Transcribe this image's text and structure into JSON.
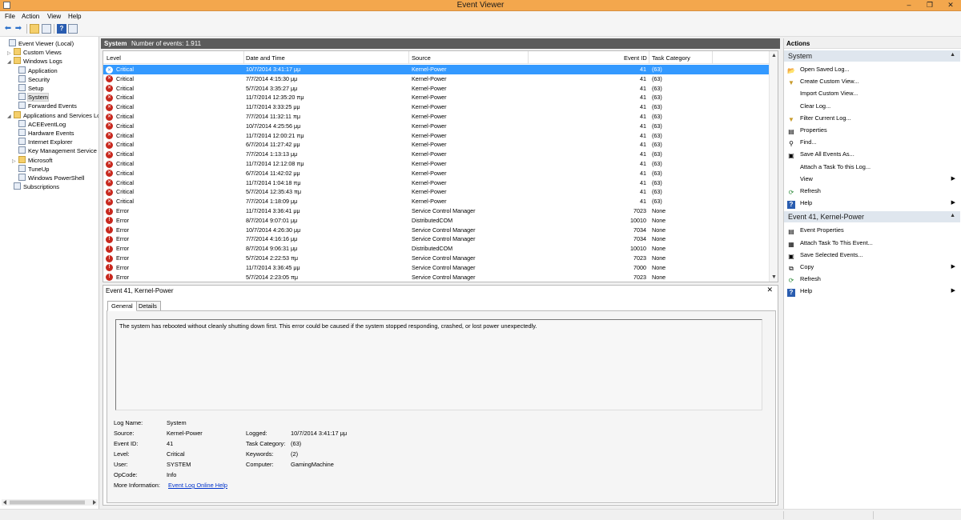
{
  "window": {
    "title": "Event Viewer",
    "minimize_glyph": "–",
    "restore_glyph": "❐",
    "close_glyph": "✕"
  },
  "menu": [
    {
      "label": "File"
    },
    {
      "label": "Action"
    },
    {
      "label": "View"
    },
    {
      "label": "Help"
    }
  ],
  "toolbar": {
    "back_icon": "back-arrow-icon",
    "forward_icon": "forward-arrow-icon",
    "up_icon": "folder-up-icon",
    "console_icon": "console-tree-icon",
    "help_icon": "help-icon",
    "pane_icon": "action-pane-icon"
  },
  "tree": {
    "items": [
      {
        "label": "Event Viewer (Local)",
        "level": 0,
        "expander": "",
        "icon": "log"
      },
      {
        "label": "Custom Views",
        "level": 1,
        "expander": "▷",
        "icon": "folder"
      },
      {
        "label": "Windows Logs",
        "level": 1,
        "expander": "◢",
        "icon": "folder"
      },
      {
        "label": "Application",
        "level": 2,
        "expander": "",
        "icon": "log"
      },
      {
        "label": "Security",
        "level": 2,
        "expander": "",
        "icon": "log"
      },
      {
        "label": "Setup",
        "level": 2,
        "expander": "",
        "icon": "log"
      },
      {
        "label": "System",
        "level": 2,
        "expander": "",
        "icon": "log",
        "selected": true
      },
      {
        "label": "Forwarded Events",
        "level": 2,
        "expander": "",
        "icon": "log"
      },
      {
        "label": "Applications and Services Lo",
        "level": 1,
        "expander": "◢",
        "icon": "folder"
      },
      {
        "label": "ACEEventLog",
        "level": 2,
        "expander": "",
        "icon": "log"
      },
      {
        "label": "Hardware Events",
        "level": 2,
        "expander": "",
        "icon": "log"
      },
      {
        "label": "Internet Explorer",
        "level": 2,
        "expander": "",
        "icon": "log"
      },
      {
        "label": "Key Management Service",
        "level": 2,
        "expander": "",
        "icon": "log"
      },
      {
        "label": "Microsoft",
        "level": 2,
        "expander": "▷",
        "icon": "folder"
      },
      {
        "label": "TuneUp",
        "level": 2,
        "expander": "",
        "icon": "log"
      },
      {
        "label": "Windows PowerShell",
        "level": 2,
        "expander": "",
        "icon": "log"
      },
      {
        "label": "Subscriptions",
        "level": 1,
        "expander": "",
        "icon": "log"
      }
    ]
  },
  "center_header": {
    "log_name": "System",
    "count_text": "Number of events: 1.911"
  },
  "events": {
    "columns": [
      "Level",
      "Date and Time",
      "Source",
      "Event ID",
      "Task Category"
    ],
    "rows": [
      {
        "level": "Critical",
        "date": "10/7/2014 3:41:17 μμ",
        "source": "Kernel-Power",
        "id": "41",
        "task": "(63)",
        "selected": true
      },
      {
        "level": "Critical",
        "date": "7/7/2014 4:15:30 μμ",
        "source": "Kernel-Power",
        "id": "41",
        "task": "(63)"
      },
      {
        "level": "Critical",
        "date": "5/7/2014 3:35:27 μμ",
        "source": "Kernel-Power",
        "id": "41",
        "task": "(63)"
      },
      {
        "level": "Critical",
        "date": "11/7/2014 12:35:20 πμ",
        "source": "Kernel-Power",
        "id": "41",
        "task": "(63)"
      },
      {
        "level": "Critical",
        "date": "11/7/2014 3:33:25 μμ",
        "source": "Kernel-Power",
        "id": "41",
        "task": "(63)"
      },
      {
        "level": "Critical",
        "date": "7/7/2014 11:32:11 πμ",
        "source": "Kernel-Power",
        "id": "41",
        "task": "(63)"
      },
      {
        "level": "Critical",
        "date": "10/7/2014 4:25:56 μμ",
        "source": "Kernel-Power",
        "id": "41",
        "task": "(63)"
      },
      {
        "level": "Critical",
        "date": "11/7/2014 12:00:21 πμ",
        "source": "Kernel-Power",
        "id": "41",
        "task": "(63)"
      },
      {
        "level": "Critical",
        "date": "6/7/2014 11:27:42 μμ",
        "source": "Kernel-Power",
        "id": "41",
        "task": "(63)"
      },
      {
        "level": "Critical",
        "date": "7/7/2014 1:13:13 μμ",
        "source": "Kernel-Power",
        "id": "41",
        "task": "(63)"
      },
      {
        "level": "Critical",
        "date": "11/7/2014 12:12:08 πμ",
        "source": "Kernel-Power",
        "id": "41",
        "task": "(63)"
      },
      {
        "level": "Critical",
        "date": "6/7/2014 11:42:02 μμ",
        "source": "Kernel-Power",
        "id": "41",
        "task": "(63)"
      },
      {
        "level": "Critical",
        "date": "11/7/2014 1:04:18 πμ",
        "source": "Kernel-Power",
        "id": "41",
        "task": "(63)"
      },
      {
        "level": "Critical",
        "date": "5/7/2014 12:35:43 πμ",
        "source": "Kernel-Power",
        "id": "41",
        "task": "(63)"
      },
      {
        "level": "Critical",
        "date": "7/7/2014 1:18:09 μμ",
        "source": "Kernel-Power",
        "id": "41",
        "task": "(63)"
      },
      {
        "level": "Error",
        "date": "11/7/2014 3:36:41 μμ",
        "source": "Service Control Manager",
        "id": "7023",
        "task": "None"
      },
      {
        "level": "Error",
        "date": "8/7/2014 9:07:01 μμ",
        "source": "DistributedCOM",
        "id": "10010",
        "task": "None"
      },
      {
        "level": "Error",
        "date": "10/7/2014 4:26:30 μμ",
        "source": "Service Control Manager",
        "id": "7034",
        "task": "None"
      },
      {
        "level": "Error",
        "date": "7/7/2014 4:16:16 μμ",
        "source": "Service Control Manager",
        "id": "7034",
        "task": "None"
      },
      {
        "level": "Error",
        "date": "8/7/2014 9:06:31 μμ",
        "source": "DistributedCOM",
        "id": "10010",
        "task": "None"
      },
      {
        "level": "Error",
        "date": "5/7/2014 2:22:53 πμ",
        "source": "Service Control Manager",
        "id": "7023",
        "task": "None"
      },
      {
        "level": "Error",
        "date": "11/7/2014 3:36:45 μμ",
        "source": "Service Control Manager",
        "id": "7000",
        "task": "None"
      },
      {
        "level": "Error",
        "date": "5/7/2014 2:23:05 πμ",
        "source": "Service Control Manager",
        "id": "7023",
        "task": "None"
      }
    ]
  },
  "details": {
    "title": "Event 41, Kernel-Power",
    "close_glyph": "✕",
    "tabs": [
      "General",
      "Details"
    ],
    "description": "The system has rebooted without cleanly shutting down first. This error could be caused if the system stopped responding, crashed, or lost power unexpectedly.",
    "fields": {
      "log_name_label": "Log Name:",
      "log_name": "System",
      "source_label": "Source:",
      "source": "Kernel-Power",
      "logged_label": "Logged:",
      "logged": "10/7/2014 3:41:17 μμ",
      "event_id_label": "Event ID:",
      "event_id": "41",
      "task_label": "Task Category:",
      "task": "(63)",
      "level_label": "Level:",
      "level": "Critical",
      "keywords_label": "Keywords:",
      "keywords": "(2)",
      "user_label": "User:",
      "user": "SYSTEM",
      "computer_label": "Computer:",
      "computer": "GamingMachine",
      "opcode_label": "OpCode:",
      "opcode": "Info",
      "more_label": "More Information:",
      "more_link": "Event Log Online Help"
    }
  },
  "actions": {
    "header": "Actions",
    "sections": [
      {
        "title": "System",
        "items": [
          {
            "label": "Open Saved Log...",
            "icon": "open-folder-icon",
            "glyph": "📂"
          },
          {
            "label": "Create Custom View...",
            "icon": "filter-icon",
            "glyph": "▼"
          },
          {
            "label": "Import Custom View...",
            "icon": "",
            "glyph": ""
          },
          {
            "label": "Clear Log...",
            "icon": "",
            "glyph": ""
          },
          {
            "label": "Filter Current Log...",
            "icon": "filter-icon",
            "glyph": "▼"
          },
          {
            "label": "Properties",
            "icon": "properties-icon",
            "glyph": "▤"
          },
          {
            "label": "Find...",
            "icon": "binoculars-icon",
            "glyph": "⚲"
          },
          {
            "label": "Save All Events As...",
            "icon": "save-icon",
            "glyph": "▣"
          },
          {
            "label": "Attach a Task To this Log...",
            "icon": "",
            "glyph": ""
          },
          {
            "label": "View",
            "icon": "",
            "glyph": "",
            "submenu": true
          },
          {
            "label": "Refresh",
            "icon": "refresh-icon",
            "glyph": "⟳"
          },
          {
            "label": "Help",
            "icon": "help-icon",
            "glyph": "?",
            "submenu": true
          }
        ]
      },
      {
        "title": "Event 41, Kernel-Power",
        "items": [
          {
            "label": "Event Properties",
            "icon": "properties-icon",
            "glyph": "▤"
          },
          {
            "label": "Attach Task To This Event...",
            "icon": "task-icon",
            "glyph": "▦"
          },
          {
            "label": "Save Selected Events...",
            "icon": "save-icon",
            "glyph": "▣"
          },
          {
            "label": "Copy",
            "icon": "copy-icon",
            "glyph": "⧉",
            "submenu": true
          },
          {
            "label": "Refresh",
            "icon": "refresh-icon",
            "glyph": "⟳"
          },
          {
            "label": "Help",
            "icon": "help-icon",
            "glyph": "?",
            "submenu": true
          }
        ]
      }
    ]
  },
  "colors": {
    "title_bar": "#f3a74d",
    "selection": "#3399ff",
    "critical_icon": "#c8281e",
    "section_header": "#dfe6ee",
    "center_header": "#5c5c5c"
  }
}
